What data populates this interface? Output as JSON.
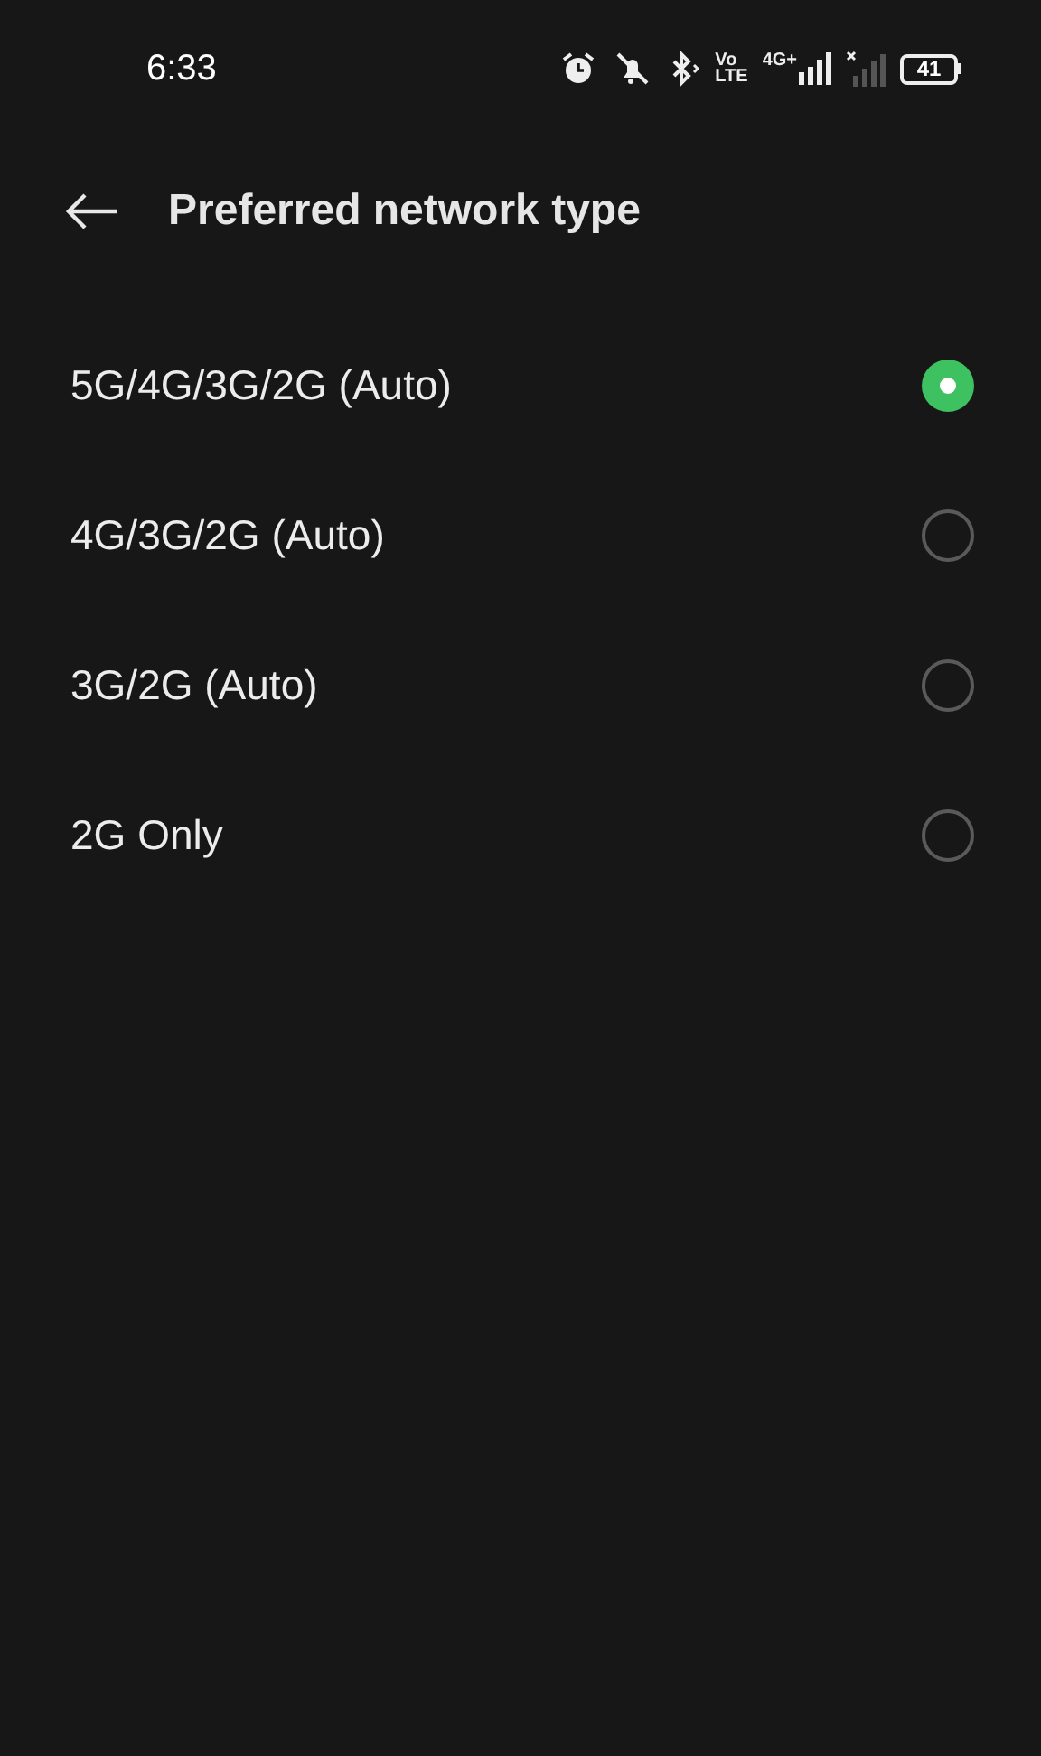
{
  "status_bar": {
    "time": "6:33",
    "volte_top": "Vo",
    "volte_bottom": "LTE",
    "network": "4G+",
    "battery": "41"
  },
  "header": {
    "title": "Preferred network type"
  },
  "options": [
    {
      "label": "5G/4G/3G/2G (Auto)",
      "selected": true
    },
    {
      "label": "4G/3G/2G (Auto)",
      "selected": false
    },
    {
      "label": "3G/2G (Auto)",
      "selected": false
    },
    {
      "label": "2G Only",
      "selected": false
    }
  ]
}
